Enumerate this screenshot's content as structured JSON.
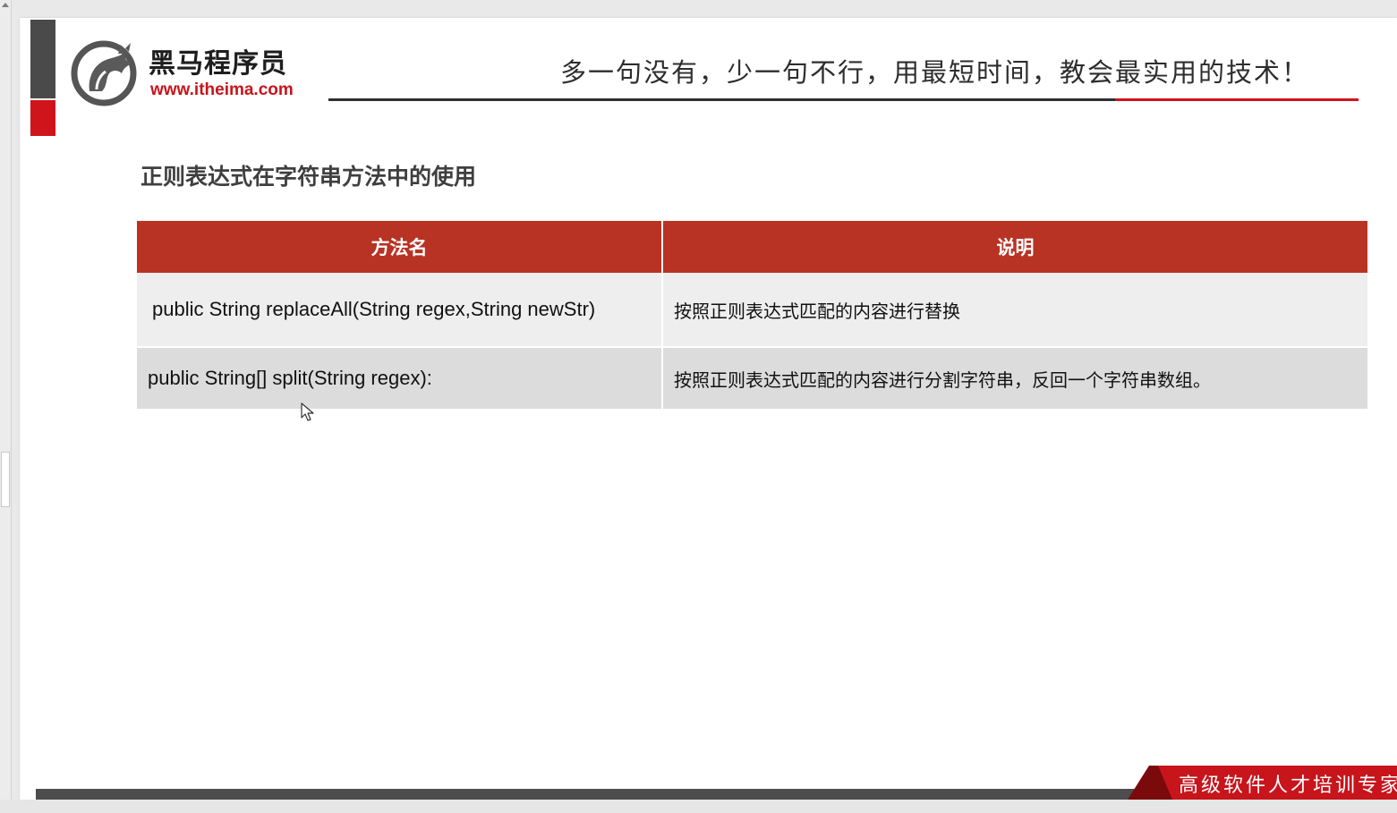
{
  "brand": {
    "name": "黑马程序员",
    "url": "www.itheima.com"
  },
  "header": {
    "slogan": "多一句没有，少一句不行，用最短时间，教会最实用的技术！"
  },
  "section": {
    "title": "正则表达式在字符串方法中的使用"
  },
  "table": {
    "headers": [
      "方法名",
      "说明"
    ],
    "rows": [
      {
        "method": "public String replaceAll(String regex,String newStr)",
        "description": "按照正则表达式匹配的内容进行替换"
      },
      {
        "method": "public String[] split(String regex):",
        "description": "按照正则表达式匹配的内容进行分割字符串，反回一个字符串数组。"
      }
    ]
  },
  "footer": {
    "tagline": "高级软件人才培训专家"
  },
  "colors": {
    "table_header": "#b83324",
    "brand_red": "#d0141b",
    "accent_gray": "#4a4a4a",
    "row_light": "#eeeeee",
    "row_dark": "#dcdcdc"
  }
}
